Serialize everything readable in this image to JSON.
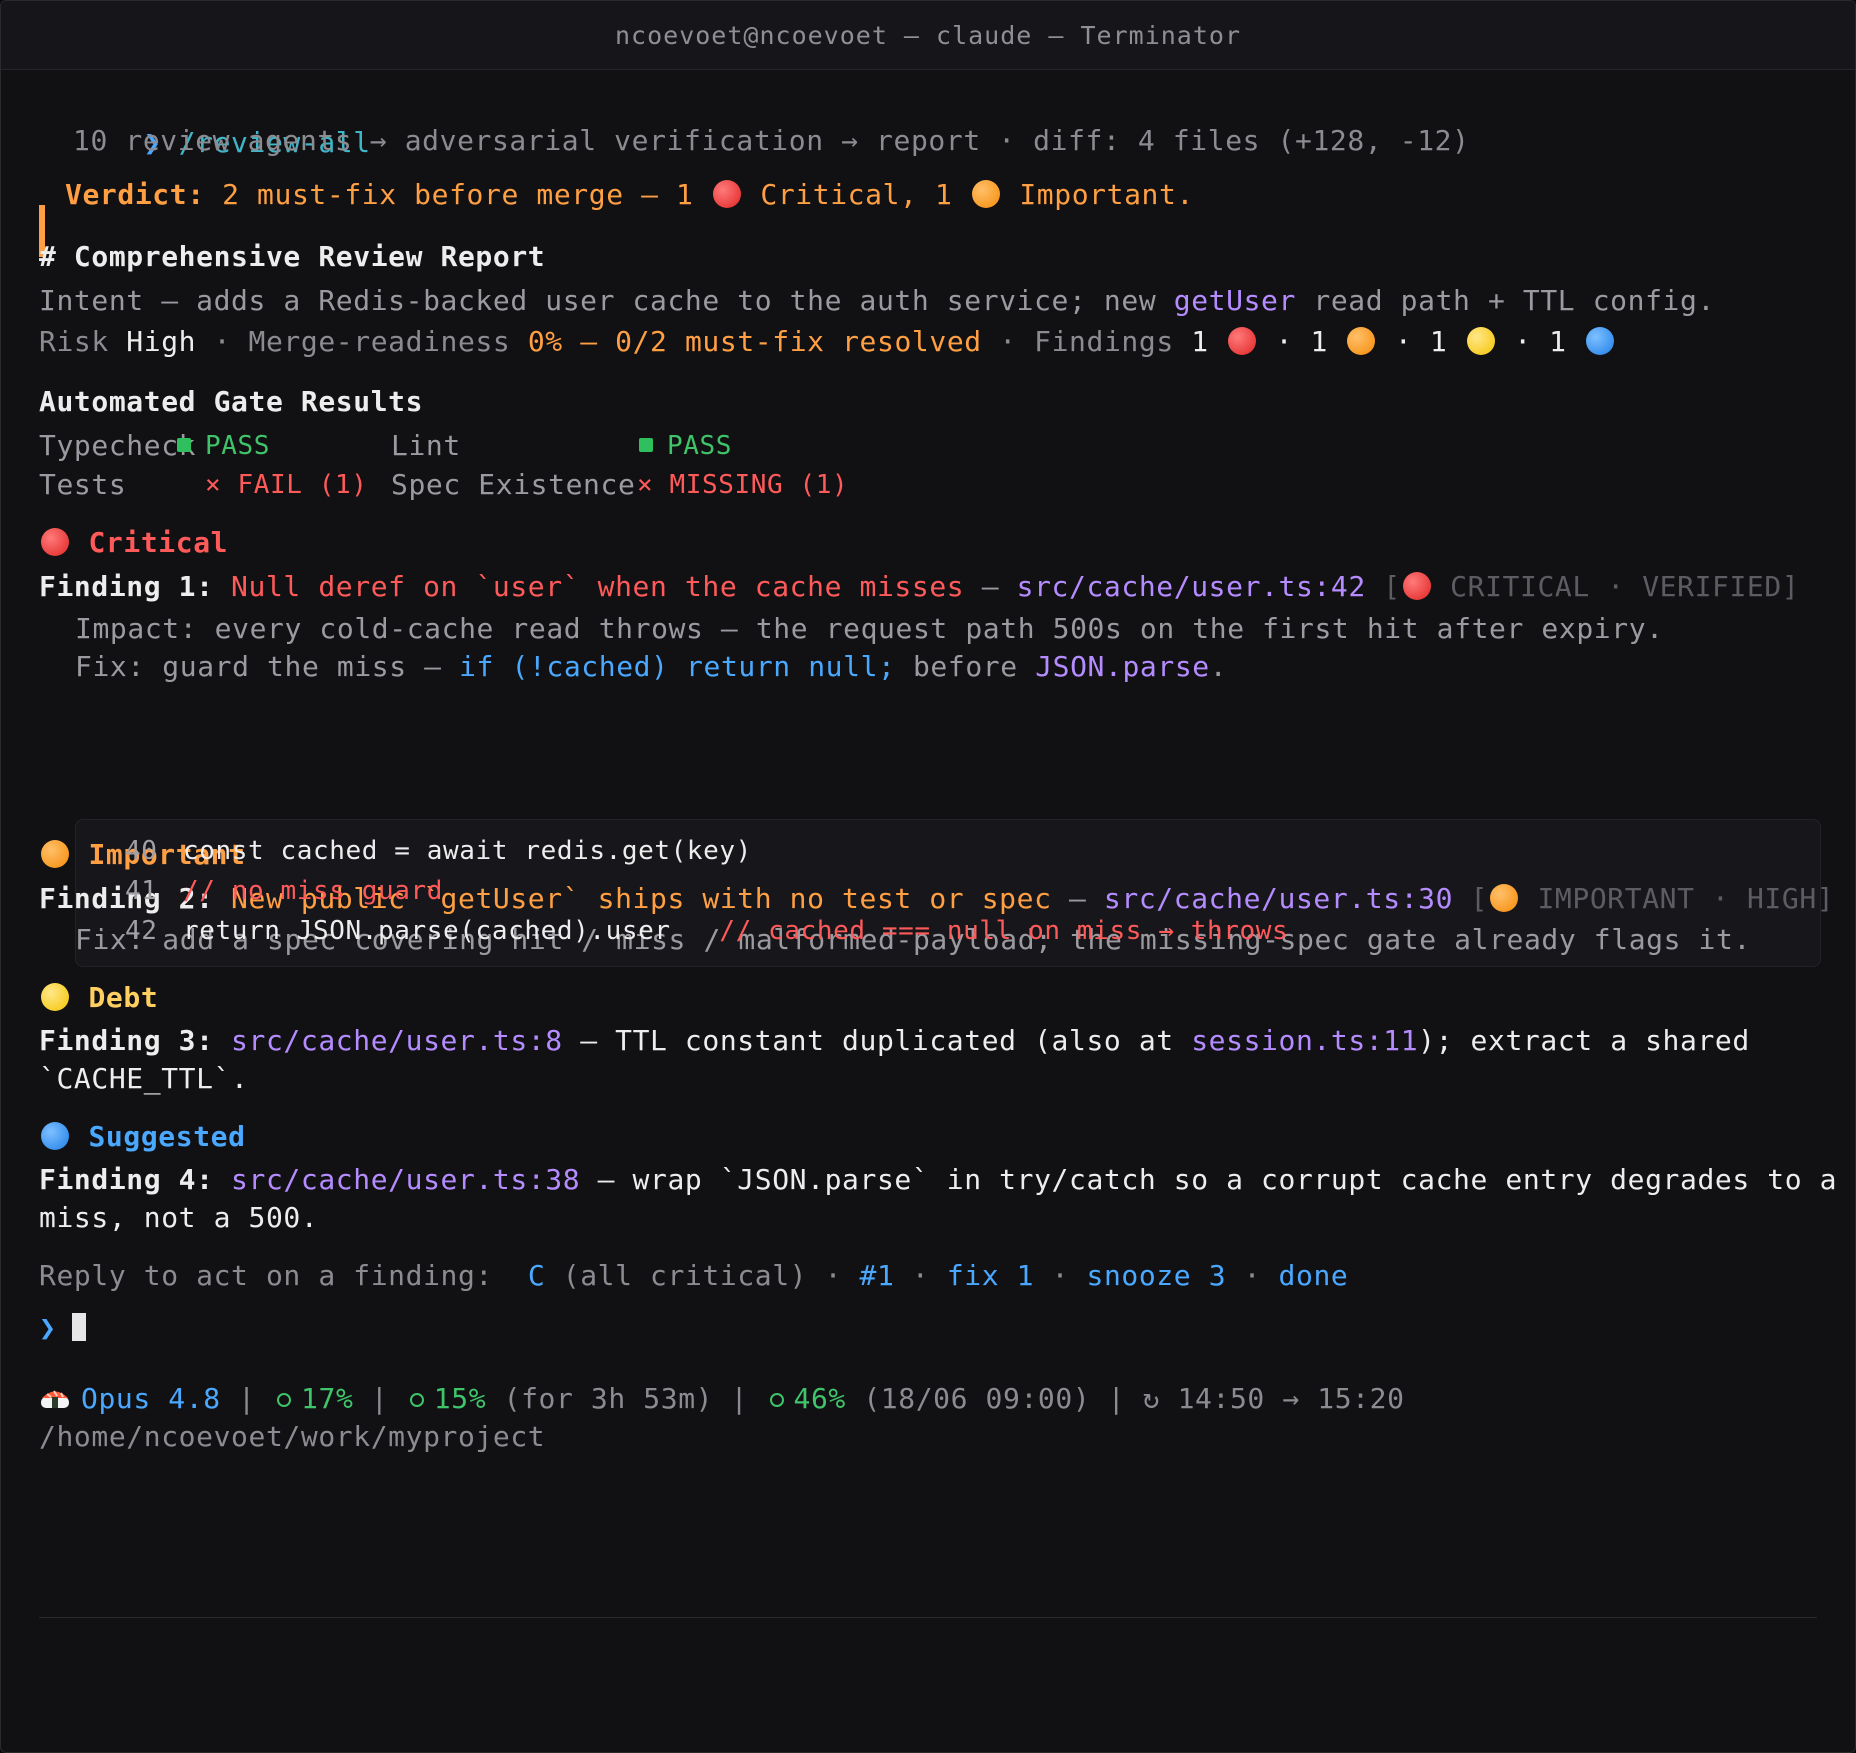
{
  "window": {
    "title": "ncoevoet@ncoevoet — claude — Terminator"
  },
  "prompt_symbol": "❯",
  "command": "/review-all",
  "pipeline": "10 review agents → adversarial verification → report · diff: 4 files (+128, -12)",
  "verdict": {
    "label": "Verdict:",
    "text_a": " 2 must-fix before merge — 1 ",
    "text_b": " Critical, 1 ",
    "text_c": " Important."
  },
  "report_heading": "# Comprehensive Review Report",
  "intent": {
    "label": "Intent — adds a Redis-backed user cache to the auth service; new ",
    "fn": "getUser",
    "rest": " read path + TTL config."
  },
  "risk": {
    "label": "Risk ",
    "value": "High",
    "sep1": " · Merge-readiness ",
    "readiness": "0% — 0/2 must-fix resolved",
    "sep2": " · Findings ",
    "c1": "1 ",
    "s1": " · 1 ",
    "s2": " · 1 ",
    "s3": " · 1 "
  },
  "gates": {
    "heading": "Automated Gate Results",
    "items": [
      {
        "name": "Typecheck",
        "status": "PASS"
      },
      {
        "name": "Lint",
        "status": "PASS"
      },
      {
        "name": "Tests",
        "status": "× FAIL (1)"
      },
      {
        "name": "Spec Existence",
        "status": "× MISSING (1)"
      }
    ]
  },
  "sections": {
    "critical": "Critical",
    "important": "Important",
    "debt": "Debt",
    "suggested": "Suggested"
  },
  "finding1": {
    "label": "Finding 1:",
    "title": " Null deref on `user` when the cache misses",
    "dash": " — ",
    "loc": "src/cache/user.ts:42",
    "tag_open": " [",
    "tag": " CRITICAL · VERIFIED]",
    "impact": "Impact: every cold-cache read throws — the request path 500s on the first hit after expiry.",
    "fix_a": "Fix: guard the miss — ",
    "fix_code": "if (!cached) return null;",
    "fix_b": " before ",
    "fix_fn": "JSON.parse",
    "fix_c": "."
  },
  "code": [
    {
      "num": "40",
      "text": "const cached = await redis.get(key)",
      "comment": ""
    },
    {
      "num": "41",
      "text": "",
      "comment": "// no miss guard"
    },
    {
      "num": "42",
      "text": "return JSON.parse(cached).user   ",
      "comment": "// cached === null on miss → throws"
    }
  ],
  "finding2": {
    "label": "Finding 2:",
    "title": " New public `getUser` ships with no test or spec",
    "dash": " — ",
    "loc": "src/cache/user.ts:30",
    "tag_open": " [",
    "tag": " IMPORTANT · HIGH]",
    "fix": "Fix: add a spec covering hit / miss / malformed-payload; the missing-spec gate already flags it."
  },
  "finding3": {
    "label": "Finding 3:",
    "loc": " src/cache/user.ts:8",
    "text_a": " — TTL constant duplicated (also at ",
    "loc2": "session.ts:11",
    "text_b": "); extract a shared",
    "text_c": "`CACHE_TTL`."
  },
  "finding4": {
    "label": "Finding 4:",
    "loc": " src/cache/user.ts:38",
    "text_a": " — wrap `JSON.parse` in try/catch so a corrupt cache entry degrades to a",
    "text_b": "miss, not a 500."
  },
  "reply": {
    "label": "Reply to act on a finding:  ",
    "opt1": "C",
    "opt1_desc": " (all critical)",
    "sep": " · ",
    "opt2": "#1",
    "opt3": "fix 1",
    "opt4": "snooze 3",
    "opt5": "done"
  },
  "status": {
    "model": "Opus 4.8",
    "bar": " | ",
    "ctx": "17%",
    "session": "15%",
    "session_desc": " (for 3h 53m)",
    "weekly": "46%",
    "weekly_desc": " (18/06 09:00)",
    "time": "14:50 → 15:20",
    "path": "/home/ncoevoet/work/myproject"
  },
  "colors": {
    "accent": "#ff9f43",
    "critical": "#ff5a5a",
    "pass": "#3fc46a",
    "link": "#b58cff",
    "cmd": "#4aa8ff"
  }
}
